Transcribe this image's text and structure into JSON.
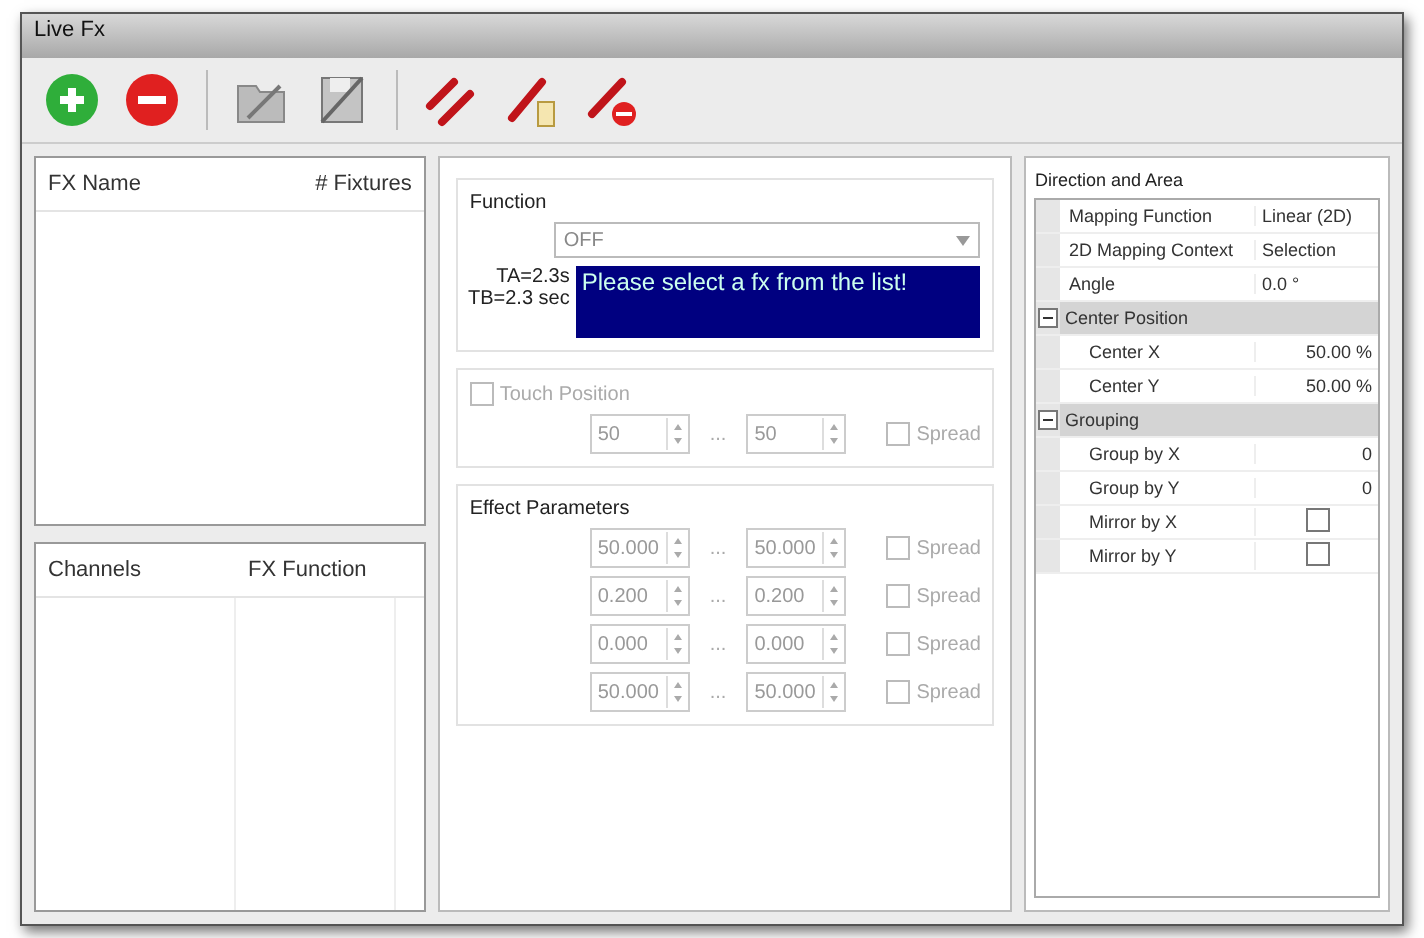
{
  "window": {
    "title": "Live Fx"
  },
  "toolbar": [
    {
      "kind": "add"
    },
    {
      "kind": "remove"
    },
    {
      "kind": "separator"
    },
    {
      "kind": "open"
    },
    {
      "kind": "save"
    },
    {
      "kind": "separator"
    },
    {
      "kind": "wires"
    },
    {
      "kind": "wire-paste"
    },
    {
      "kind": "wire-remove"
    }
  ],
  "fx_list": {
    "columns": [
      "FX Name",
      "# Fixtures"
    ]
  },
  "channels": {
    "columns": [
      "Channels",
      "FX Function"
    ]
  },
  "function": {
    "label": "Function",
    "value": "OFF",
    "timing": [
      "TA=2.3s",
      "TB=2.3 sec"
    ],
    "message": "Please select a fx from the list!"
  },
  "touch_position": {
    "label": "Touch Position",
    "checked": false,
    "disabled": true,
    "from": "50",
    "to": "50",
    "separator": "...",
    "spread": {
      "label": "Spread",
      "checked": false
    }
  },
  "effect_parameters": {
    "label": "Effect Parameters",
    "disabled": true,
    "rows": [
      {
        "from": "50.000",
        "to": "50.000",
        "separator": "...",
        "spread": {
          "label": "Spread",
          "checked": false
        }
      },
      {
        "from": "0.200",
        "to": "0.200",
        "separator": "...",
        "spread": {
          "label": "Spread",
          "checked": false
        }
      },
      {
        "from": "0.000",
        "to": "0.000",
        "separator": "...",
        "spread": {
          "label": "Spread",
          "checked": false
        }
      },
      {
        "from": "50.000",
        "to": "50.000",
        "separator": "...",
        "spread": {
          "label": "Spread",
          "checked": false
        }
      }
    ]
  },
  "direction_area": {
    "title": "Direction and Area",
    "rows": [
      {
        "kind": "property",
        "name": "Mapping Function",
        "value": "Linear (2D)"
      },
      {
        "kind": "property",
        "name": "2D Mapping Context",
        "value": "Selection"
      },
      {
        "kind": "property",
        "name": "Angle",
        "value": "0.0 °"
      },
      {
        "kind": "category",
        "name": "Center Position",
        "expanded": true,
        "children": [
          {
            "kind": "property",
            "name": "Center X",
            "value": "50.00 %"
          },
          {
            "kind": "property",
            "name": "Center Y",
            "value": "50.00 %"
          }
        ]
      },
      {
        "kind": "category",
        "name": "Grouping",
        "expanded": true,
        "children": [
          {
            "kind": "property",
            "name": "Group by X",
            "value": "0"
          },
          {
            "kind": "property",
            "name": "Group by Y",
            "value": "0"
          },
          {
            "kind": "checkbox",
            "name": "Mirror by X",
            "checked": false
          },
          {
            "kind": "checkbox",
            "name": "Mirror by Y",
            "checked": false
          }
        ]
      }
    ]
  }
}
